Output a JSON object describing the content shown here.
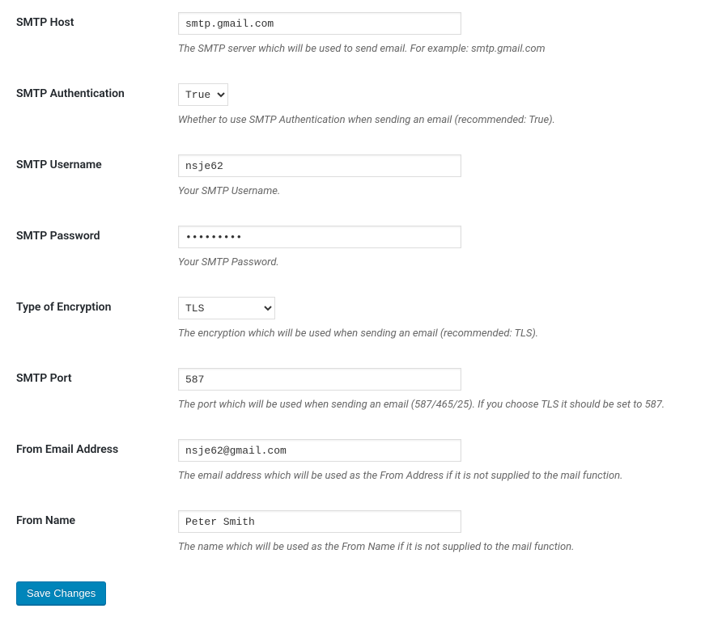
{
  "fields": {
    "smtp_host": {
      "label": "SMTP Host",
      "value": "smtp.gmail.com",
      "description": "The SMTP server which will be used to send email. For example: smtp.gmail.com"
    },
    "smtp_auth": {
      "label": "SMTP Authentication",
      "value": "True",
      "description": "Whether to use SMTP Authentication when sending an email (recommended: True)."
    },
    "smtp_username": {
      "label": "SMTP Username",
      "value": "nsje62",
      "description": "Your SMTP Username."
    },
    "smtp_password": {
      "label": "SMTP Password",
      "value": "•••••••••",
      "description": "Your SMTP Password."
    },
    "encryption": {
      "label": "Type of Encryption",
      "value": "TLS",
      "description": "The encryption which will be used when sending an email (recommended: TLS)."
    },
    "smtp_port": {
      "label": "SMTP Port",
      "value": "587",
      "description": "The port which will be used when sending an email (587/465/25). If you choose TLS it should be set to 587."
    },
    "from_email": {
      "label": "From Email Address",
      "value": "nsje62@gmail.com",
      "description": "The email address which will be used as the From Address if it is not supplied to the mail function."
    },
    "from_name": {
      "label": "From Name",
      "value": "Peter Smith",
      "description": "The name which will be used as the From Name if it is not supplied to the mail function."
    }
  },
  "submit": {
    "label": "Save Changes"
  }
}
